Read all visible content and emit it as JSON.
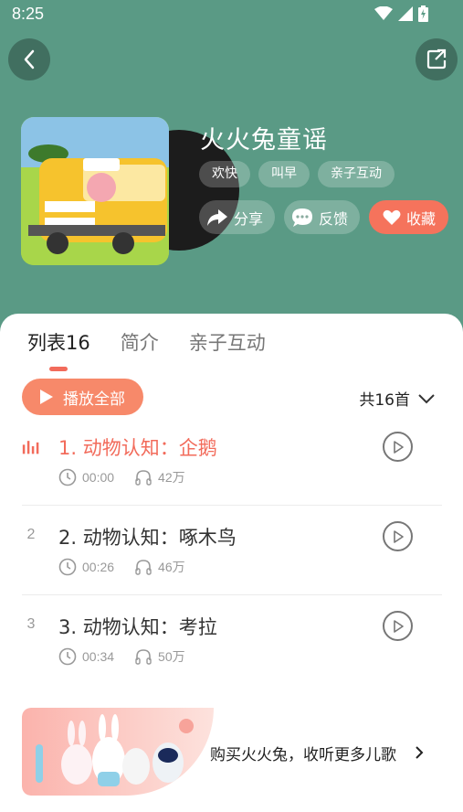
{
  "status": {
    "time": "8:25"
  },
  "album": {
    "title": "火火兔童谣",
    "tags": [
      "欢快",
      "叫早",
      "亲子互动"
    ]
  },
  "actions": {
    "share": "分享",
    "feedback": "反馈",
    "favorite": "收藏"
  },
  "tabs": [
    {
      "label": "列表16"
    },
    {
      "label": "简介"
    },
    {
      "label": "亲子互动"
    }
  ],
  "list": {
    "play_all": "播放全部",
    "count": "共16首"
  },
  "tracks": [
    {
      "index": "",
      "title": "1. 动物认知：企鹅",
      "duration": "00:00",
      "plays": "42万"
    },
    {
      "index": "2",
      "title": "2. 动物认知：啄木鸟",
      "duration": "00:26",
      "plays": "46万"
    },
    {
      "index": "3",
      "title": "3. 动物认知：考拉",
      "duration": "00:34",
      "plays": "50万"
    }
  ],
  "banner": {
    "text": "购买火火兔，收听更多儿歌"
  },
  "colors": {
    "header": "#5a9a85",
    "accent": "#f26b5b",
    "play_all": "#f7896a",
    "favorite": "#f5735c"
  },
  "icons": [
    "wifi-icon",
    "signal-icon",
    "battery-icon",
    "back-icon",
    "share-out-icon",
    "share-icon",
    "chat-icon",
    "heart-icon",
    "play-icon",
    "chevron-down-icon",
    "equalizer-icon",
    "clock-icon",
    "headphones-icon",
    "chevron-right-icon"
  ]
}
